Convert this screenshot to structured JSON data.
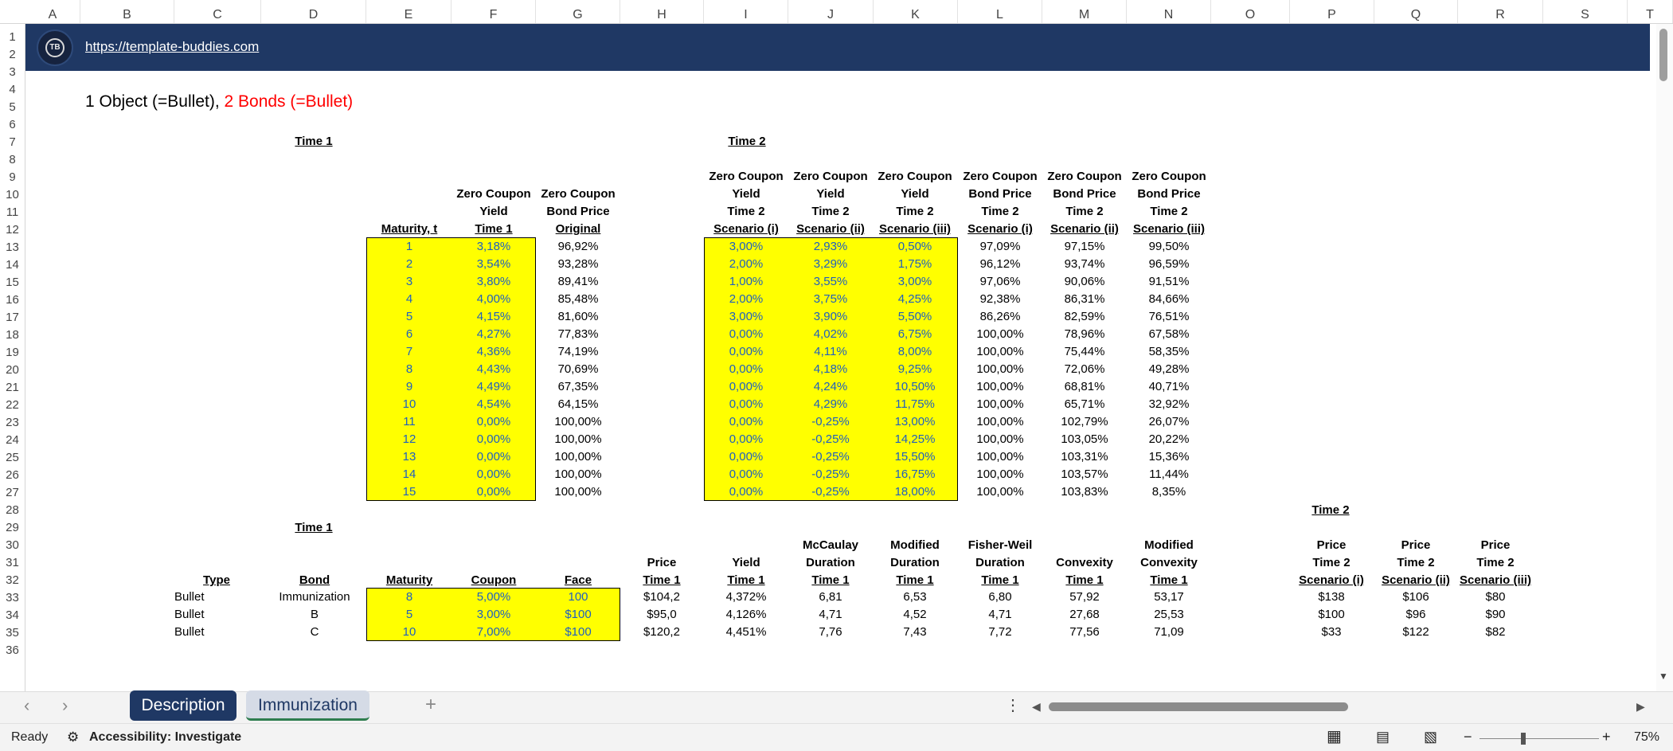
{
  "columns": [
    "A",
    "B",
    "C",
    "D",
    "E",
    "F",
    "G",
    "H",
    "I",
    "J",
    "K",
    "L",
    "M",
    "N",
    "O",
    "P",
    "Q",
    "R",
    "S",
    "T"
  ],
  "rows": [
    "1",
    "2",
    "3",
    "4",
    "5",
    "6",
    "7",
    "8",
    "9",
    "10",
    "11",
    "12",
    "13",
    "14",
    "15",
    "16",
    "17",
    "18",
    "19",
    "20",
    "21",
    "22",
    "23",
    "24",
    "25",
    "26",
    "27",
    "28",
    "29",
    "30",
    "31",
    "32",
    "33",
    "34",
    "35",
    "36"
  ],
  "banner": {
    "url": "https://template-buddies.com",
    "logo_text": "TB"
  },
  "title": {
    "part1": "1 Object (=Bullet), ",
    "part2": "2 Bonds (=Bullet)"
  },
  "section_time1_top": "Time 1",
  "section_time2_top": "Time 2",
  "top_headers": {
    "maturity": [
      "",
      "",
      "",
      "Maturity, t"
    ],
    "yield_t1": [
      "",
      "Zero Coupon",
      "Yield",
      "Time 1"
    ],
    "price_orig": [
      "",
      "Zero Coupon",
      "Bond Price",
      "Original"
    ],
    "y2_i": [
      "Zero Coupon",
      "Yield",
      "Time 2",
      "Scenario (i)"
    ],
    "y2_ii": [
      "Zero Coupon",
      "Yield",
      "Time 2",
      "Scenario (ii)"
    ],
    "y2_iii": [
      "Zero Coupon",
      "Yield",
      "Time 2",
      "Scenario (iii)"
    ],
    "p2_i": [
      "Zero Coupon",
      "Bond Price",
      "Time 2",
      "Scenario (i)"
    ],
    "p2_ii": [
      "Zero Coupon",
      "Bond Price",
      "Time 2",
      "Scenario (ii)"
    ],
    "p2_iii": [
      "Zero Coupon",
      "Bond Price",
      "Time 2",
      "Scenario (iii)"
    ]
  },
  "top_table": [
    {
      "t": "1",
      "y1": "3,18%",
      "p1": "96,92%",
      "yi": "3,00%",
      "yii": "2,93%",
      "yiii": "0,50%",
      "pi": "97,09%",
      "pii": "97,15%",
      "piii": "99,50%"
    },
    {
      "t": "2",
      "y1": "3,54%",
      "p1": "93,28%",
      "yi": "2,00%",
      "yii": "3,29%",
      "yiii": "1,75%",
      "pi": "96,12%",
      "pii": "93,74%",
      "piii": "96,59%"
    },
    {
      "t": "3",
      "y1": "3,80%",
      "p1": "89,41%",
      "yi": "1,00%",
      "yii": "3,55%",
      "yiii": "3,00%",
      "pi": "97,06%",
      "pii": "90,06%",
      "piii": "91,51%"
    },
    {
      "t": "4",
      "y1": "4,00%",
      "p1": "85,48%",
      "yi": "2,00%",
      "yii": "3,75%",
      "yiii": "4,25%",
      "pi": "92,38%",
      "pii": "86,31%",
      "piii": "84,66%"
    },
    {
      "t": "5",
      "y1": "4,15%",
      "p1": "81,60%",
      "yi": "3,00%",
      "yii": "3,90%",
      "yiii": "5,50%",
      "pi": "86,26%",
      "pii": "82,59%",
      "piii": "76,51%"
    },
    {
      "t": "6",
      "y1": "4,27%",
      "p1": "77,83%",
      "yi": "0,00%",
      "yii": "4,02%",
      "yiii": "6,75%",
      "pi": "100,00%",
      "pii": "78,96%",
      "piii": "67,58%"
    },
    {
      "t": "7",
      "y1": "4,36%",
      "p1": "74,19%",
      "yi": "0,00%",
      "yii": "4,11%",
      "yiii": "8,00%",
      "pi": "100,00%",
      "pii": "75,44%",
      "piii": "58,35%"
    },
    {
      "t": "8",
      "y1": "4,43%",
      "p1": "70,69%",
      "yi": "0,00%",
      "yii": "4,18%",
      "yiii": "9,25%",
      "pi": "100,00%",
      "pii": "72,06%",
      "piii": "49,28%"
    },
    {
      "t": "9",
      "y1": "4,49%",
      "p1": "67,35%",
      "yi": "0,00%",
      "yii": "4,24%",
      "yiii": "10,50%",
      "pi": "100,00%",
      "pii": "68,81%",
      "piii": "40,71%"
    },
    {
      "t": "10",
      "y1": "4,54%",
      "p1": "64,15%",
      "yi": "0,00%",
      "yii": "4,29%",
      "yiii": "11,75%",
      "pi": "100,00%",
      "pii": "65,71%",
      "piii": "32,92%"
    },
    {
      "t": "11",
      "y1": "0,00%",
      "p1": "100,00%",
      "yi": "0,00%",
      "yii": "-0,25%",
      "yiii": "13,00%",
      "pi": "100,00%",
      "pii": "102,79%",
      "piii": "26,07%"
    },
    {
      "t": "12",
      "y1": "0,00%",
      "p1": "100,00%",
      "yi": "0,00%",
      "yii": "-0,25%",
      "yiii": "14,25%",
      "pi": "100,00%",
      "pii": "103,05%",
      "piii": "20,22%"
    },
    {
      "t": "13",
      "y1": "0,00%",
      "p1": "100,00%",
      "yi": "0,00%",
      "yii": "-0,25%",
      "yiii": "15,50%",
      "pi": "100,00%",
      "pii": "103,31%",
      "piii": "15,36%"
    },
    {
      "t": "14",
      "y1": "0,00%",
      "p1": "100,00%",
      "yi": "0,00%",
      "yii": "-0,25%",
      "yiii": "16,75%",
      "pi": "100,00%",
      "pii": "103,57%",
      "piii": "11,44%"
    },
    {
      "t": "15",
      "y1": "0,00%",
      "p1": "100,00%",
      "yi": "0,00%",
      "yii": "-0,25%",
      "yiii": "18,00%",
      "pi": "100,00%",
      "pii": "103,83%",
      "piii": "8,35%"
    }
  ],
  "section_time1_bottom": "Time 1",
  "section_time2_bottom": "Time 2",
  "bottom_headers": {
    "type": [
      "",
      "",
      "Type"
    ],
    "bond": [
      "",
      "",
      "Bond"
    ],
    "maturity": [
      "",
      "",
      "Maturity"
    ],
    "coupon": [
      "",
      "",
      "Coupon"
    ],
    "face": [
      "",
      "",
      "Face"
    ],
    "price": [
      "",
      "Price",
      "Time 1"
    ],
    "yield": [
      "",
      "Yield",
      "Time 1"
    ],
    "mcdur": [
      "McCaulay",
      "Duration",
      "Time 1"
    ],
    "moddur": [
      "Modified",
      "Duration",
      "Time 1"
    ],
    "fwdur": [
      "Fisher-Weil",
      "Duration",
      "Time 1"
    ],
    "conv": [
      "",
      "Convexity",
      "Time 1"
    ],
    "modconv": [
      "Modified",
      "Convexity",
      "Time 1"
    ],
    "p2i": [
      "Price",
      "Time 2",
      "Scenario (i)"
    ],
    "p2ii": [
      "Price",
      "Time 2",
      "Scenario (ii)"
    ],
    "p2iii": [
      "Price",
      "Time 2",
      "Scenario (iii)"
    ]
  },
  "bottom_table": [
    {
      "type": "Bullet",
      "bond": "Immunization",
      "mat": "8",
      "cpn": "5,00%",
      "face": "100",
      "price": "$104,2",
      "yld": "4,372%",
      "mc": "6,81",
      "md": "6,53",
      "fw": "6,80",
      "cv": "57,92",
      "mcv": "53,17",
      "p2i": "$138",
      "p2ii": "$106",
      "p2iii": "$80"
    },
    {
      "type": "Bullet",
      "bond": "B",
      "mat": "5",
      "cpn": "3,00%",
      "face": "$100",
      "price": "$95,0",
      "yld": "4,126%",
      "mc": "4,71",
      "md": "4,52",
      "fw": "4,71",
      "cv": "27,68",
      "mcv": "25,53",
      "p2i": "$100",
      "p2ii": "$96",
      "p2iii": "$90"
    },
    {
      "type": "Bullet",
      "bond": "C",
      "mat": "10",
      "cpn": "7,00%",
      "face": "$100",
      "price": "$120,2",
      "yld": "4,451%",
      "mc": "7,76",
      "md": "7,43",
      "fw": "7,72",
      "cv": "77,56",
      "mcv": "71,09",
      "p2i": "$33",
      "p2ii": "$122",
      "p2iii": "$82"
    }
  ],
  "tabs": [
    "Description",
    "Immunization"
  ],
  "status": {
    "ready": "Ready",
    "accessibility": "Accessibility: Investigate",
    "zoom": "75%"
  },
  "colors": {
    "banner": "#1f3864",
    "highlight": "#ffff00",
    "input_text": "#1f5fbf",
    "title_red": "#ff0000"
  }
}
